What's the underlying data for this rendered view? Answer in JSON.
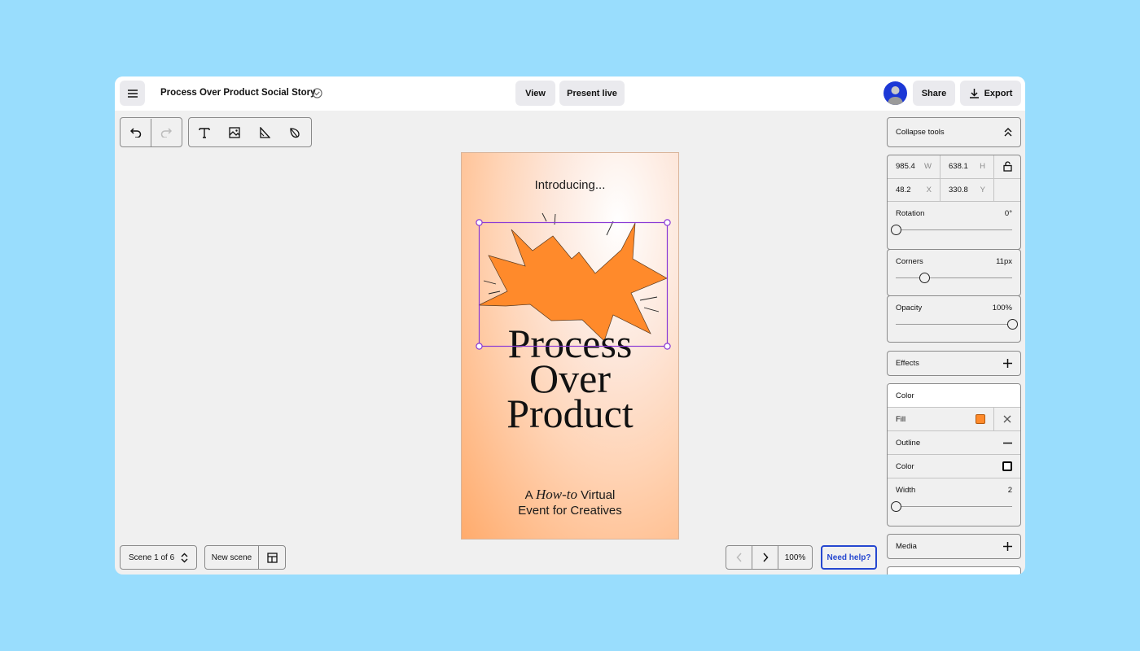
{
  "header": {
    "document_title": "Process Over Product Social Story",
    "view_label": "View",
    "present_label": "Present live",
    "share_label": "Share",
    "export_label": "Export"
  },
  "canvas": {
    "intro": "Introducing...",
    "headline": [
      "Process",
      "Over",
      "Product"
    ],
    "sub_prefix": "A ",
    "sub_italic": "How-to",
    "sub_suffix": " Virtual",
    "sub_line2": "Event for Creatives",
    "shape_fill": "#ff8a2b",
    "selection_color": "#8a3ad6"
  },
  "footer": {
    "scene_label": "Scene 1 of 6",
    "new_scene_label": "New scene",
    "zoom": "100%",
    "help_label": "Need help?"
  },
  "panel": {
    "collapse_label": "Collapse tools",
    "width_value": "985.4",
    "width_unit": "W",
    "height_value": "638.1",
    "height_unit": "H",
    "x_value": "48.2",
    "x_unit": "X",
    "y_value": "330.8",
    "y_unit": "Y",
    "rotation_label": "Rotation",
    "rotation_value": "0°",
    "rotation_fraction": 0.0,
    "corners_label": "Corners",
    "corners_value": "11px",
    "corners_fraction": 0.25,
    "opacity_label": "Opacity",
    "opacity_value": "100%",
    "opacity_fraction": 1.0,
    "effects_label": "Effects",
    "color_label": "Color",
    "fill_label": "Fill",
    "fill_color": "#ff8a2b",
    "outline_label": "Outline",
    "outline_color_label": "Color",
    "outline_color": "#000000",
    "outline_width_label": "Width",
    "outline_width_value": "2",
    "outline_width_fraction": 0.0,
    "media_label": "Media"
  }
}
